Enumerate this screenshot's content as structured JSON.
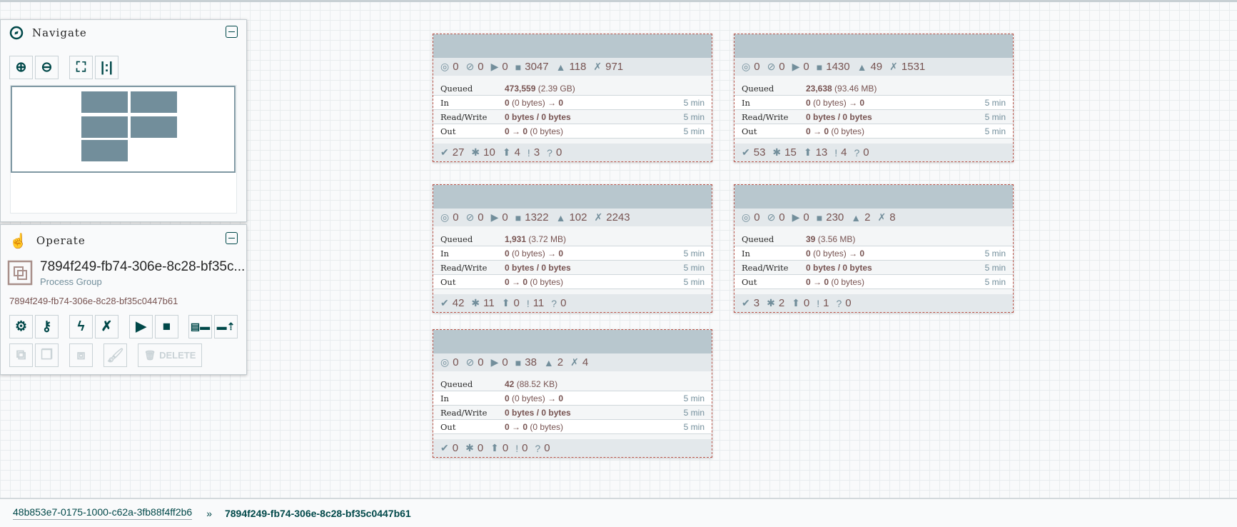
{
  "navigate": {
    "title": "Navigate"
  },
  "operate": {
    "title": "Operate",
    "name": "7894f249-fb74-306e-8c28-bf35c...",
    "type": "Process Group",
    "id": "7894f249-fb74-306e-8c28-bf35c0447b61",
    "delete_label": "DELETE"
  },
  "labels": {
    "queued": "Queued",
    "in": "In",
    "rw": "Read/Write",
    "out": "Out",
    "time": "5 min"
  },
  "cards": [
    {
      "transmitting": "0",
      "not_transmitting": "0",
      "running": "0",
      "stopped": "3047",
      "invalid": "118",
      "disabled": "971",
      "queued_count": "473,559",
      "queued_size": "(2.39 GB)",
      "in_count": "0",
      "in_size": "(0 bytes)",
      "in_arrow": "→ 0",
      "rw": "0 bytes / 0 bytes",
      "out_count": "0 → 0",
      "out_size": "(0 bytes)",
      "up_to_date": "27",
      "locally_modified": "10",
      "stale": "4",
      "mod_stale": "3",
      "sync_failure": "0"
    },
    {
      "transmitting": "0",
      "not_transmitting": "0",
      "running": "0",
      "stopped": "1430",
      "invalid": "49",
      "disabled": "1531",
      "queued_count": "23,638",
      "queued_size": "(93.46 MB)",
      "in_count": "0",
      "in_size": "(0 bytes)",
      "in_arrow": "→ 0",
      "rw": "0 bytes / 0 bytes",
      "out_count": "0 → 0",
      "out_size": "(0 bytes)",
      "up_to_date": "53",
      "locally_modified": "15",
      "stale": "13",
      "mod_stale": "4",
      "sync_failure": "0"
    },
    {
      "transmitting": "0",
      "not_transmitting": "0",
      "running": "0",
      "stopped": "1322",
      "invalid": "102",
      "disabled": "2243",
      "queued_count": "1,931",
      "queued_size": "(3.72 MB)",
      "in_count": "0",
      "in_size": "(0 bytes)",
      "in_arrow": "→ 0",
      "rw": "0 bytes / 0 bytes",
      "out_count": "0 → 0",
      "out_size": "(0 bytes)",
      "up_to_date": "42",
      "locally_modified": "11",
      "stale": "0",
      "mod_stale": "11",
      "sync_failure": "0"
    },
    {
      "transmitting": "0",
      "not_transmitting": "0",
      "running": "0",
      "stopped": "230",
      "invalid": "2",
      "disabled": "8",
      "queued_count": "39",
      "queued_size": "(3.56 MB)",
      "in_count": "0",
      "in_size": "(0 bytes)",
      "in_arrow": "→ 0",
      "rw": "0 bytes / 0 bytes",
      "out_count": "0 → 0",
      "out_size": "(0 bytes)",
      "up_to_date": "3",
      "locally_modified": "2",
      "stale": "0",
      "mod_stale": "1",
      "sync_failure": "0"
    },
    {
      "transmitting": "0",
      "not_transmitting": "0",
      "running": "0",
      "stopped": "38",
      "invalid": "2",
      "disabled": "4",
      "queued_count": "42",
      "queued_size": "(88.52 KB)",
      "in_count": "0",
      "in_size": "(0 bytes)",
      "in_arrow": "→ 0",
      "rw": "0 bytes / 0 bytes",
      "out_count": "0 → 0",
      "out_size": "(0 bytes)",
      "up_to_date": "0",
      "locally_modified": "0",
      "stale": "0",
      "mod_stale": "0",
      "sync_failure": "0"
    }
  ],
  "breadcrumb": {
    "parent": "48b853e7-0175-1000-c62a-3fb88f4ff2b6",
    "separator": "»",
    "current": "7894f249-fb74-306e-8c28-bf35c0447b61"
  },
  "colors": {
    "accent": "#004849",
    "card_border": "#ba554a",
    "value": "#775351",
    "icon": "#728e9b"
  }
}
